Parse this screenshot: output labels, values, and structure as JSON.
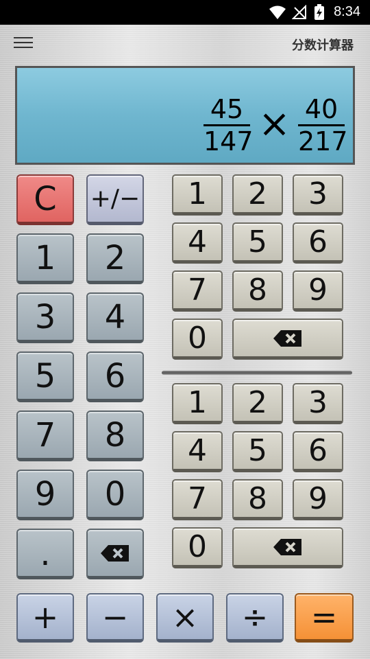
{
  "status_bar": {
    "time": "8:34"
  },
  "header": {
    "title": "分数计算器"
  },
  "display": {
    "left_fraction": {
      "numerator": "45",
      "denominator": "147"
    },
    "operator": "×",
    "right_fraction": {
      "numerator": "40",
      "denominator": "217"
    }
  },
  "left_pad": {
    "clear": "C",
    "sign": "+/−",
    "digits": [
      "1",
      "2",
      "3",
      "4",
      "5",
      "6",
      "7",
      "8",
      "9",
      "0"
    ],
    "decimal": "."
  },
  "numerator_pad": {
    "digits": [
      "1",
      "2",
      "3",
      "4",
      "5",
      "6",
      "7",
      "8",
      "9",
      "0"
    ]
  },
  "denominator_pad": {
    "digits": [
      "1",
      "2",
      "3",
      "4",
      "5",
      "6",
      "7",
      "8",
      "9",
      "0"
    ]
  },
  "operators": {
    "add": "+",
    "subtract": "−",
    "multiply": "×",
    "divide": "÷",
    "equals": "="
  },
  "colors": {
    "display_bg": "#6fb6cf",
    "clear_key": "#e06461",
    "equals_key": "#f59136"
  },
  "icons": {
    "backspace": "backspace-icon",
    "menu": "menu-icon"
  }
}
